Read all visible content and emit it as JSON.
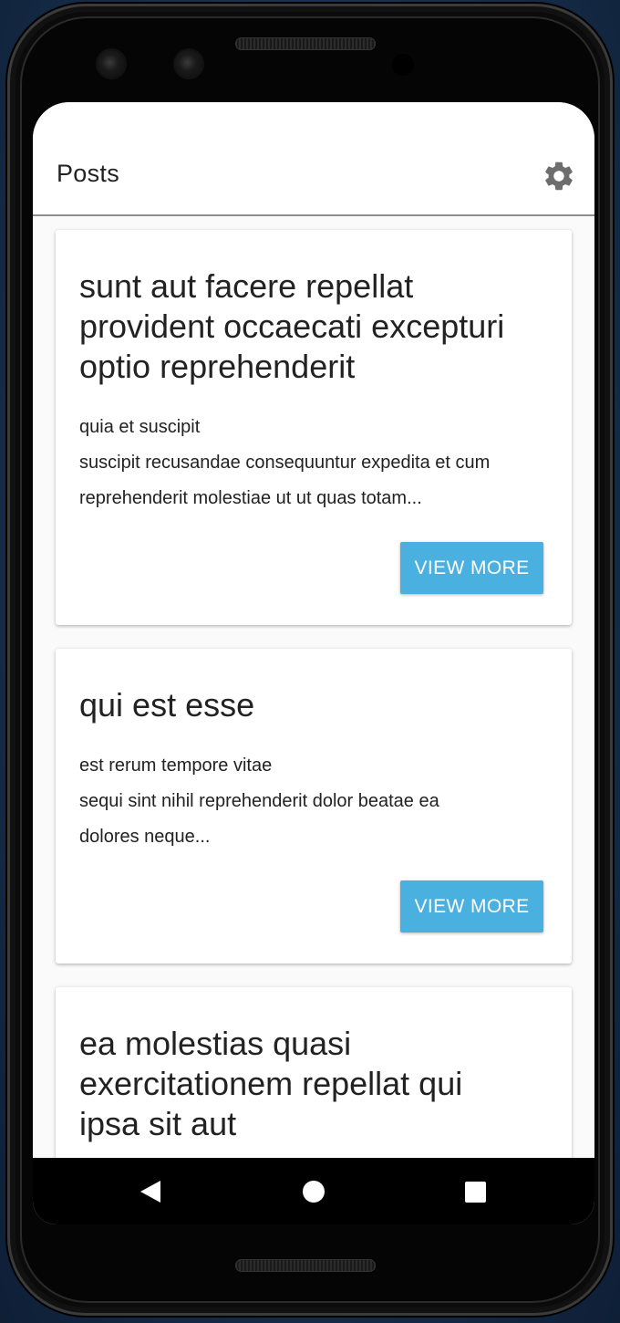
{
  "app": {
    "title": "Posts",
    "settings_icon": "gear-icon",
    "accent_color": "#4ab0df"
  },
  "posts": [
    {
      "title_lines": [
        "sunt aut facere repellat",
        "provident occaecati excepturi",
        "optio reprehenderit"
      ],
      "body_lines": [
        "quia et suscipit",
        "suscipit recusandae consequuntur expedita et cum",
        "reprehenderit molestiae ut ut quas totam..."
      ],
      "button_label": "VIEW MORE"
    },
    {
      "title_lines": [
        "qui est esse"
      ],
      "body_lines": [
        "est rerum tempore vitae",
        "sequi sint nihil reprehenderit dolor beatae ea",
        "dolores neque..."
      ],
      "button_label": "VIEW MORE"
    },
    {
      "title_lines": [
        "ea molestias quasi",
        "exercitationem repellat qui",
        "ipsa sit aut"
      ],
      "body_lines": [],
      "button_label": ""
    }
  ],
  "nav": {
    "back_icon": "back-triangle-icon",
    "home_icon": "home-circle-icon",
    "recents_icon": "recents-square-icon"
  }
}
